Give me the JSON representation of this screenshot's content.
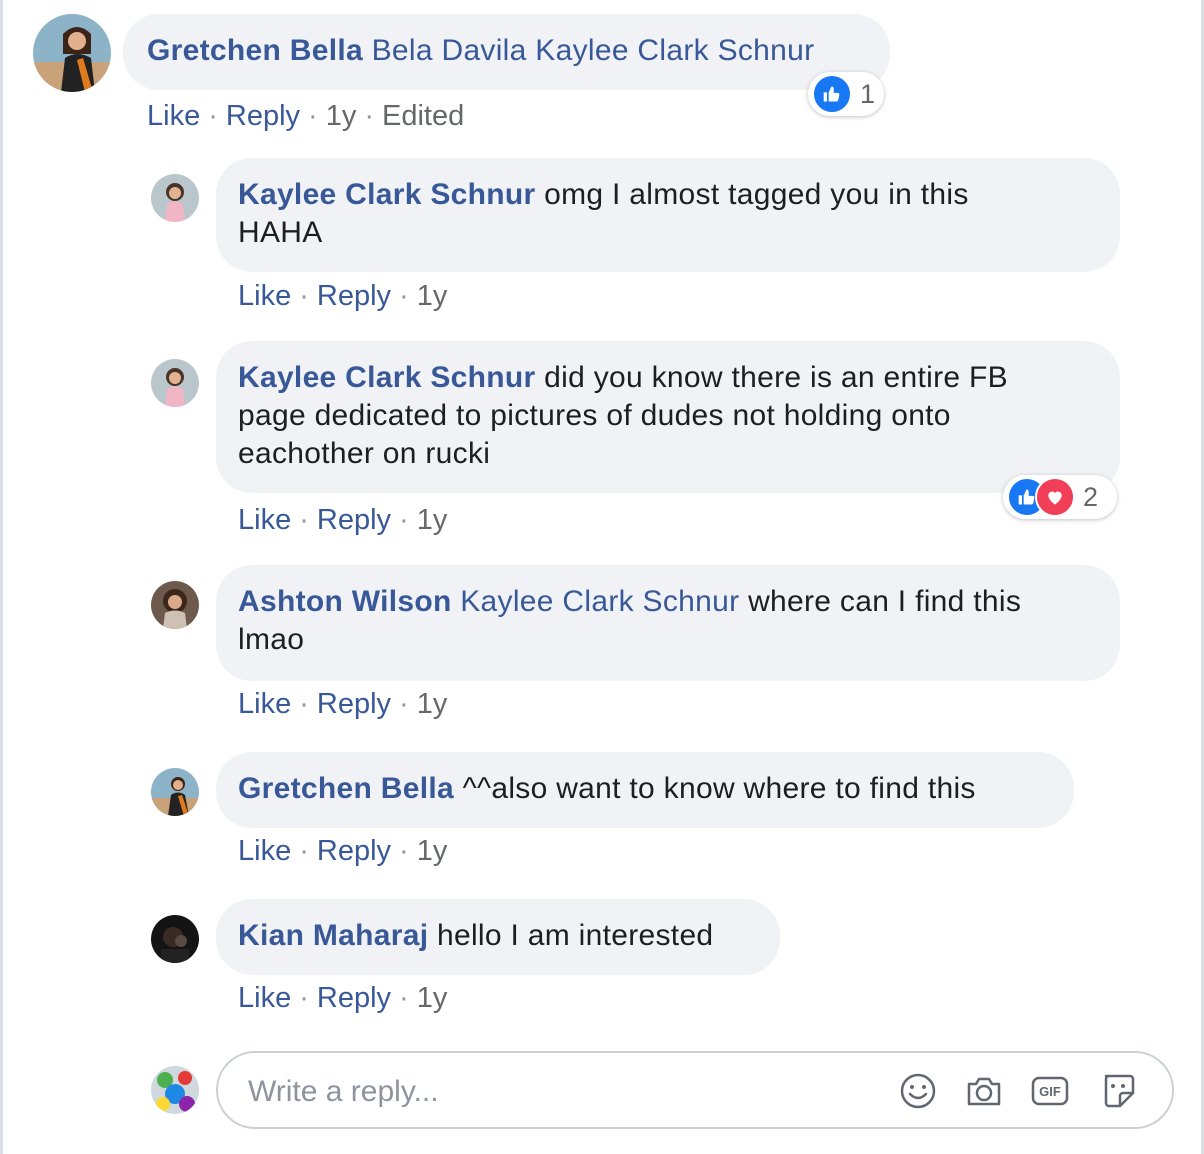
{
  "comment": {
    "author": "Gretchen Bella",
    "tags": "Bela Davila Kaylee Clark Schnur",
    "reaction_count": "1",
    "actions": {
      "like": "Like",
      "reply": "Reply",
      "time": "1y",
      "edited": "Edited"
    }
  },
  "replies": [
    {
      "author": "Kaylee Clark Schnur",
      "line1": "omg I almost tagged you in this",
      "line2": "HAHA",
      "like": "Like",
      "reply": "Reply",
      "time": "1y"
    },
    {
      "author": "Kaylee Clark Schnur",
      "line1": "did you know there is an entire FB",
      "line2": "page dedicated to pictures of dudes not holding onto",
      "line3": "eachother on rucki",
      "like": "Like",
      "reply": "Reply",
      "time": "1y",
      "reaction_count": "2"
    },
    {
      "author": "Ashton Wilson",
      "tag": "Kaylee Clark Schnur",
      "line1": "where can I find this",
      "line2": "lmao",
      "like": "Like",
      "reply": "Reply",
      "time": "1y"
    },
    {
      "author": "Gretchen Bella",
      "line1": "^^also want to know where to find this",
      "like": "Like",
      "reply": "Reply",
      "time": "1y"
    },
    {
      "author": "Kian Maharaj",
      "line1": "hello I am interested",
      "like": "Like",
      "reply": "Reply",
      "time": "1y"
    }
  ],
  "composer": {
    "placeholder": "Write a reply...",
    "icons": [
      "emoji-icon",
      "camera-icon",
      "gif-icon",
      "sticker-icon"
    ]
  },
  "colors": {
    "link": "#385898",
    "bubble": "#f0f2f5",
    "like_blue": "#1877f2",
    "love_red": "#f33e58"
  }
}
